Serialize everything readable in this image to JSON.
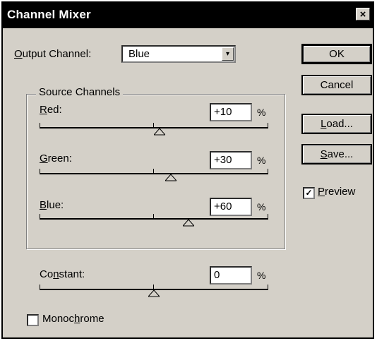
{
  "window": {
    "title": "Channel Mixer",
    "close_glyph": "×"
  },
  "output_channel": {
    "label_underlined": "O",
    "label_rest": "utput Channel:",
    "value": "Blue",
    "arrow": "▾"
  },
  "buttons": {
    "ok": "OK",
    "cancel": "Cancel",
    "load_u": "L",
    "load_rest": "oad...",
    "save_u": "S",
    "save_rest": "ave..."
  },
  "preview": {
    "checked": true,
    "check_glyph": "✓",
    "label_u": "P",
    "label_rest": "review"
  },
  "source_channels": {
    "label": "Source Channels",
    "channels": [
      {
        "label_u": "R",
        "label_rest": "ed:",
        "value": "+10",
        "percent_sign": "%",
        "level_percent": 10
      },
      {
        "label_u": "G",
        "label_rest": "reen:",
        "value": "+30",
        "percent_sign": "%",
        "level_percent": 30
      },
      {
        "label_u": "B",
        "label_rest": "lue:",
        "value": "+60",
        "percent_sign": "%",
        "level_percent": 60
      }
    ]
  },
  "constant": {
    "label_pre": "Co",
    "label_u": "n",
    "label_rest": "stant:",
    "value": "0",
    "percent_sign": "%",
    "level_percent": 0
  },
  "monochrome": {
    "checked": false,
    "label_pre": "Monoc",
    "label_u": "h",
    "label_rest": "rome"
  },
  "slider_range": {
    "min": -200,
    "max": 200
  },
  "colors": {
    "titlebar": "#000000",
    "face": "#d4d0c8"
  }
}
